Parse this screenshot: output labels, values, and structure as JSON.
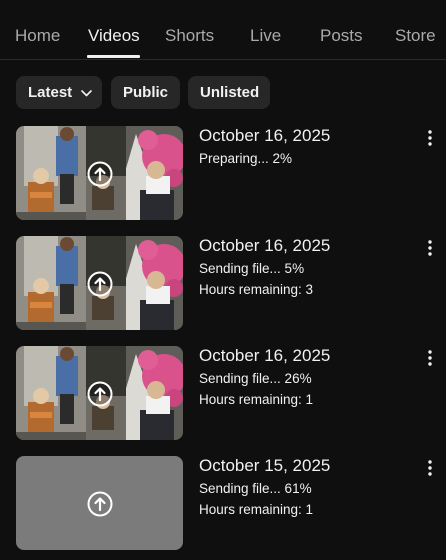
{
  "tabs": [
    {
      "label": "Home"
    },
    {
      "label": "Videos"
    },
    {
      "label": "Shorts"
    },
    {
      "label": "Live"
    },
    {
      "label": "Posts"
    },
    {
      "label": "Store"
    }
  ],
  "active_tab": "Videos",
  "filters": {
    "sort": {
      "label": "Latest",
      "icon": "chevron-down-icon"
    },
    "public": {
      "label": "Public"
    },
    "unlisted": {
      "label": "Unlisted"
    }
  },
  "videos": [
    {
      "date": "October 16, 2025",
      "status": "Preparing... 2%",
      "remaining": "",
      "progress": 0.02,
      "thumbnail": "image"
    },
    {
      "date": "October 16, 2025",
      "status": "Sending file... 5%",
      "remaining": "Hours remaining: 3",
      "progress": 0.05,
      "thumbnail": "image"
    },
    {
      "date": "October 16, 2025",
      "status": "Sending file... 26%",
      "remaining": "Hours remaining: 1",
      "progress": 0.26,
      "thumbnail": "image"
    },
    {
      "date": "October 15, 2025",
      "status": "Sending file... 61%",
      "remaining": "Hours remaining: 1",
      "progress": 0.61,
      "thumbnail": "blank"
    }
  ],
  "colors": {
    "background": "#0f0f0f",
    "chip": "#272727",
    "text": "#f1f1f1",
    "inactive_tab": "#aaaaaa",
    "blank_thumbnail": "#7b7b7b"
  }
}
